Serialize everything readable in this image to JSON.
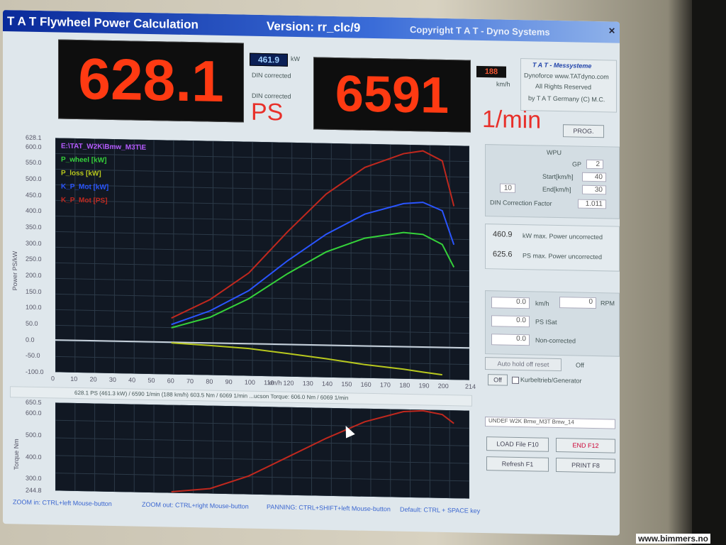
{
  "window": {
    "title": "T A T  Flywheel Power Calculation",
    "version": "Version: rr_clc/9",
    "copyright": "Copyright  T A T - Dyno Systems"
  },
  "display": {
    "power_value": "628.1",
    "power_unit": "PS",
    "kw_value": "461.9",
    "kw_unit": "kW",
    "din1": "DIN corrected",
    "din2": "DIN corrected",
    "rpm_value": "6591",
    "rpm_unit": "1/min",
    "speed_value": "188",
    "speed_unit": "km/h",
    "prog_button": "PROG."
  },
  "info_box": {
    "line1": "T A T  -  Messysteme",
    "line2": "Dynoforce  www.TATdyno.com",
    "line3": "All Rights Reserved",
    "line4": "by  T A T  Germany (C) M.C."
  },
  "settings_panel": {
    "title": "WPU",
    "gp_label": "GP",
    "gp_value": "2",
    "start_label": "Start[km/h]",
    "start_value": "40",
    "small_value": "10",
    "end_label": "End[km/h]",
    "end_value": "30",
    "din_label": "DIN Correction Factor",
    "din_value": "1.011"
  },
  "readouts": [
    {
      "value": "460.9",
      "label": "kW  max. Power uncorrected"
    },
    {
      "value": "625.6",
      "label": "PS  max. Power uncorrected"
    }
  ],
  "live_panel": {
    "speed_value": "0.0",
    "speed_label": "km/h",
    "rpm_value": "0",
    "rpm_label": "RPM",
    "p_value": "0.0",
    "p_label": "PS ISat",
    "u_value": "0.0",
    "u_label": "Non-corrected"
  },
  "controls": {
    "calc_button": "Auto hold off reset",
    "off_label": "Off",
    "off_button": "Off",
    "check_label": "Kurbeltrieb/Generator",
    "file_label": "UNDEF  W2K  Bmw_M3T  Bmw_14",
    "load_button": "LOAD File   F10",
    "end_button": "END   F12",
    "refresh_button": "Refresh   F1",
    "print_button": "PRINT   F8"
  },
  "power_chart_info": "628.1 PS  (461.3 kW) / 6590 1/min (188 km/h)      603.5 Nm / 6069 1/min    ...ucson   Torque: 606.0 Nm / 6069 1/min",
  "status_bar": {
    "zoom_in": "ZOOM in: CTRL+left Mouse-button",
    "zoom_out": "ZOOM out: CTRL+right Mouse-button",
    "panning": "PANNING: CTRL+SHIFT+left Mouse-button",
    "default": "Default: CTRL + SPACE key"
  },
  "watermark": "www.bimmers.no",
  "colors": {
    "red": "#c0281e",
    "blue": "#2a55ff",
    "green": "#35d23a",
    "yellow": "#b8c81e"
  },
  "chart_data": [
    {
      "type": "line",
      "xlabel": "km/h",
      "ylabel": "Power PS/kW",
      "ylim": [
        -100,
        628.1
      ],
      "y_ticks": [
        "628.1",
        "600.0",
        "550.0",
        "500.0",
        "450.0",
        "400.0",
        "350.0",
        "300.0",
        "250.0",
        "200.0",
        "150.0",
        "100.0",
        "50.0",
        "0.0",
        "-50.0",
        "-100.0"
      ],
      "x_ticks": [
        "0",
        "10",
        "20",
        "30",
        "40",
        "50",
        "60",
        "70",
        "80",
        "90",
        "100",
        "110",
        "120",
        "130",
        "140",
        "150",
        "160",
        "170",
        "180",
        "190",
        "200",
        "214"
      ],
      "legend": [
        {
          "name": "E:\\TAT_W2K\\Bmw_M3T\\E",
          "color": "#b65bff"
        },
        {
          "name": "P_wheel    [kW]",
          "color": "#35d23a"
        },
        {
          "name": "P_loss     [kW]",
          "color": "#b8c81e"
        },
        {
          "name": "K_P_Mot    [kW]",
          "color": "#2a55ff"
        },
        {
          "name": "K_P_Mot    [PS]",
          "color": "#c0281e"
        }
      ],
      "series": [
        {
          "name": "P_wheel [kW]",
          "color": "#35d23a",
          "x": [
            60,
            80,
            100,
            120,
            140,
            160,
            180,
            190,
            200,
            206
          ],
          "y": [
            45,
            80,
            140,
            220,
            290,
            335,
            355,
            350,
            320,
            250
          ]
        },
        {
          "name": "K_P_Mot [kW]",
          "color": "#2a55ff",
          "x": [
            60,
            80,
            100,
            120,
            140,
            160,
            180,
            190,
            200,
            206
          ],
          "y": [
            55,
            100,
            165,
            260,
            345,
            410,
            445,
            450,
            425,
            320
          ]
        },
        {
          "name": "K_P_Mot [PS]",
          "color": "#c0281e",
          "x": [
            60,
            80,
            100,
            120,
            140,
            160,
            180,
            190,
            200,
            206
          ],
          "y": [
            75,
            135,
            220,
            350,
            470,
            555,
            600,
            610,
            580,
            440
          ]
        },
        {
          "name": "P_loss [kW]",
          "color": "#b8c81e",
          "x": [
            60,
            80,
            100,
            120,
            140,
            160,
            180,
            190,
            200
          ],
          "y": [
            -2,
            -8,
            -15,
            -28,
            -42,
            -58,
            -70,
            -78,
            -85
          ]
        }
      ]
    },
    {
      "type": "line",
      "ylabel": "Torque Nm",
      "ylim": [
        244.8,
        650.5
      ],
      "y_ticks": [
        "650.5",
        "600.0",
        "500.0",
        "400.0",
        "300.0",
        "244.8"
      ],
      "series": [
        {
          "name": "Torque",
          "color": "#c0281e",
          "x": [
            60,
            80,
            100,
            120,
            140,
            160,
            180,
            190,
            200,
            206
          ],
          "y": [
            250,
            268,
            330,
            420,
            510,
            590,
            640,
            646,
            630,
            590
          ]
        }
      ]
    }
  ]
}
